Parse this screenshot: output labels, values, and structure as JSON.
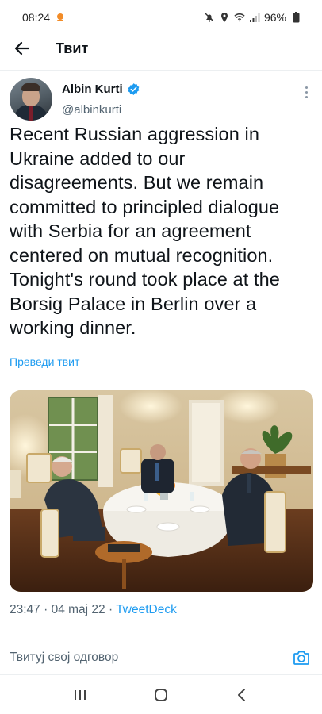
{
  "status_bar": {
    "time": "08:24",
    "battery": "96%",
    "icons": [
      "notification-dot-icon",
      "mute-icon",
      "location-icon",
      "wifi-icon",
      "signal-icon",
      "battery-icon"
    ]
  },
  "header": {
    "title": "Твит",
    "back_icon": "arrow-left-icon"
  },
  "tweet": {
    "author_name": "Albin Kurti",
    "author_handle": "@albinkurti",
    "verified": true,
    "text": "Recent Russian aggression in Ukraine added to our disagreements. But we remain committed to principled dialogue with Serbia for an agreement centered on mutual recognition. Tonight's round took place at the Borsig Palace in Berlin over a working dinner.",
    "translate_label": "Преведи твит",
    "time": "23:47",
    "date": "04 maj 22",
    "separator": "·",
    "source": "TweetDeck"
  },
  "reply": {
    "placeholder": "Твитуј свој одговор"
  },
  "nav": {
    "recents_icon": "recents-icon",
    "home_icon": "home-icon",
    "back_icon": "chevron-left-icon"
  },
  "colors": {
    "accent": "#1d9bf0",
    "text": "#0f1419",
    "secondary": "#536471"
  }
}
